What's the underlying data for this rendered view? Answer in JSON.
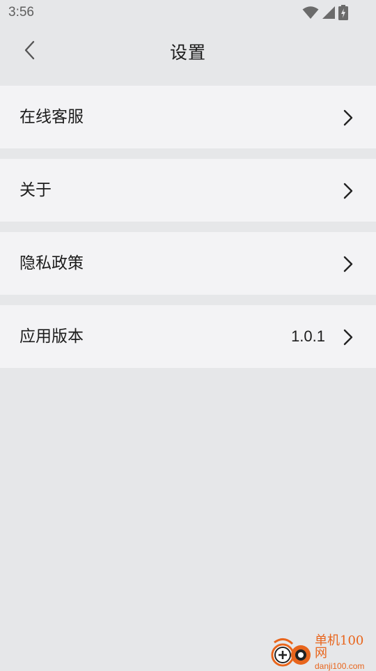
{
  "status_bar": {
    "time": "3:56",
    "icons": [
      "wifi-icon",
      "signal-icon",
      "battery-charging-icon"
    ]
  },
  "app_bar": {
    "back_icon": "chevron-left-icon",
    "title": "设置"
  },
  "settings": {
    "items": [
      {
        "label": "在线客服",
        "value": ""
      },
      {
        "label": "关于",
        "value": ""
      },
      {
        "label": "隐私政策",
        "value": ""
      },
      {
        "label": "应用版本",
        "value": "1.0.1"
      }
    ]
  },
  "watermark": {
    "brand_cn": "单机100网",
    "brand_url": "danji100.com",
    "accent_color": "#e8651c"
  },
  "colors": {
    "background": "#e6e7e9",
    "row_background": "#f3f3f5",
    "text": "#1c1c1c"
  }
}
